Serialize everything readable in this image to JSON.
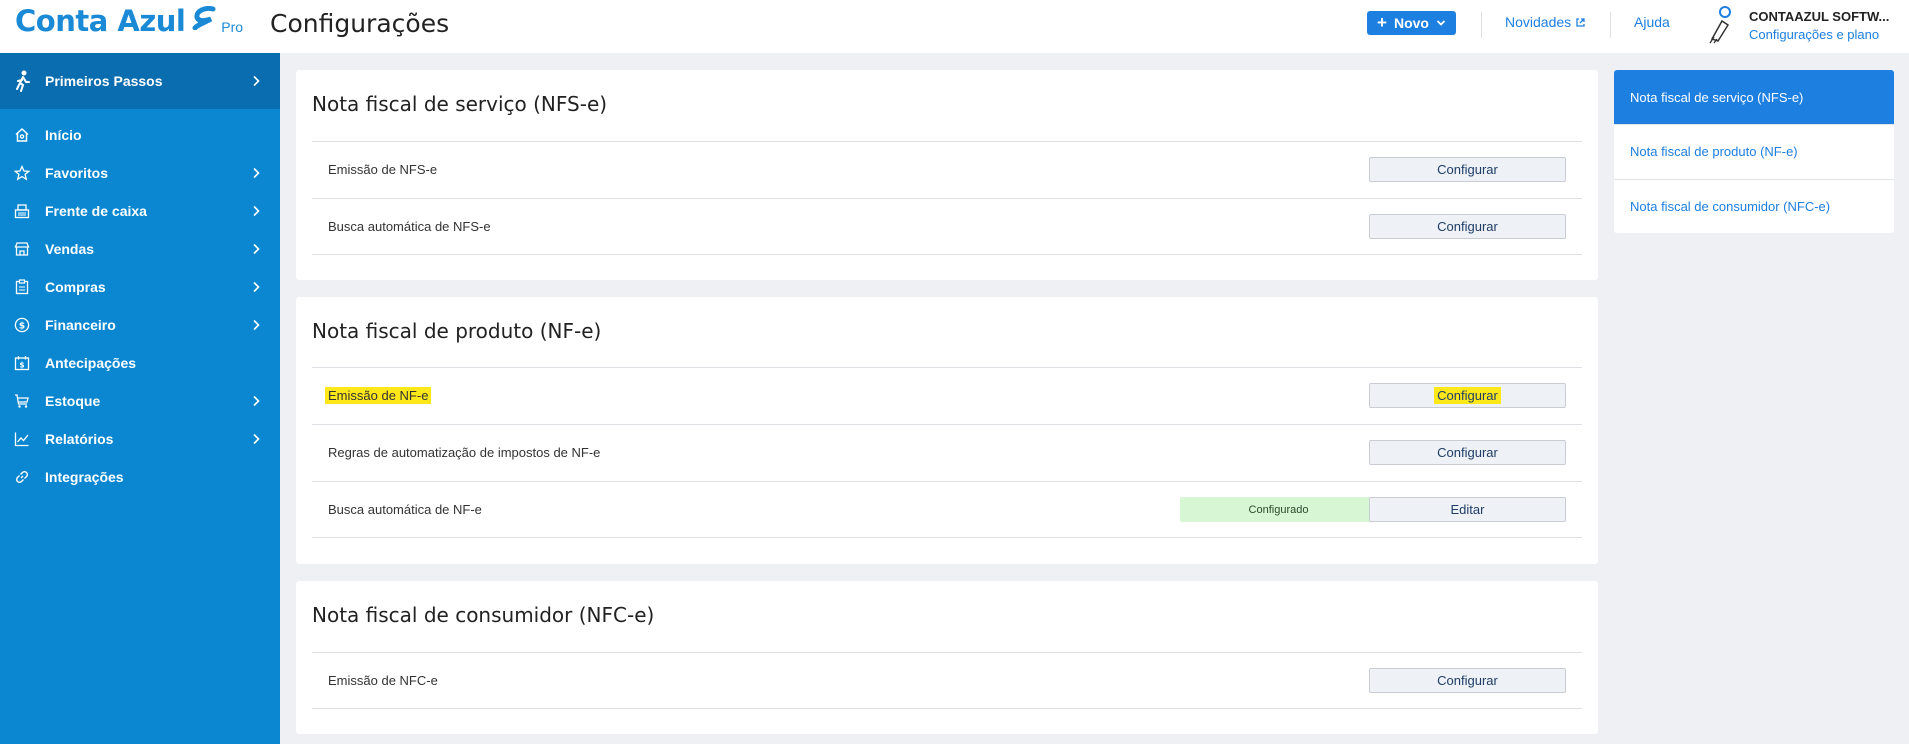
{
  "header": {
    "logo_text": "Conta Azul",
    "logo_badge": "Pro",
    "page_title": "Configurações",
    "new_button": "Novo",
    "news_link": "Novidades",
    "help_link": "Ajuda",
    "account_name": "CONTAAZUL SOFTW...",
    "account_sub": "Configurações e plano"
  },
  "sidebar": {
    "first": {
      "label": "Primeiros Passos",
      "icon": "walking-person-icon"
    },
    "items": [
      {
        "label": "Início",
        "icon": "home-icon",
        "has_submenu": false
      },
      {
        "label": "Favoritos",
        "icon": "star-icon",
        "has_submenu": true
      },
      {
        "label": "Frente de caixa",
        "icon": "cash-register-icon",
        "has_submenu": true
      },
      {
        "label": "Vendas",
        "icon": "store-icon",
        "has_submenu": true
      },
      {
        "label": "Compras",
        "icon": "clipboard-icon",
        "has_submenu": true
      },
      {
        "label": "Financeiro",
        "icon": "dollar-circle-icon",
        "has_submenu": true
      },
      {
        "label": "Antecipações",
        "icon": "calendar-dollar-icon",
        "has_submenu": false
      },
      {
        "label": "Estoque",
        "icon": "cart-icon",
        "has_submenu": true
      },
      {
        "label": "Relatórios",
        "icon": "chart-line-icon",
        "has_submenu": true
      },
      {
        "label": "Integrações",
        "icon": "link-icon",
        "has_submenu": false
      }
    ]
  },
  "sections": [
    {
      "title": "Nota fiscal de serviço (NFS-e)",
      "rows": [
        {
          "label": "Emissão de NFS-e",
          "button": "Configurar"
        },
        {
          "label": "Busca automática de NFS-e",
          "button": "Configurar"
        }
      ]
    },
    {
      "title": "Nota fiscal de produto (NF-e)",
      "rows": [
        {
          "label": "Emissão de NF-e",
          "button": "Configurar",
          "highlighted": true
        },
        {
          "label": "Regras de automatização de impostos de NF-e",
          "button": "Configurar"
        },
        {
          "label": "Busca automática de NF-e",
          "button": "Editar",
          "status": "Configurado"
        }
      ]
    },
    {
      "title": "Nota fiscal de consumidor (NFC-e)",
      "rows": [
        {
          "label": "Emissão de NFC-e",
          "button": "Configurar"
        }
      ]
    }
  ],
  "right_nav": {
    "items": [
      {
        "label": "Nota fiscal de serviço (NFS-e)",
        "active": true
      },
      {
        "label": "Nota fiscal de produto (NF-e)",
        "active": false
      },
      {
        "label": "Nota fiscal de consumidor (NFC-e)",
        "active": false
      }
    ]
  },
  "colors": {
    "brand": "#1a8ad6",
    "sidebar": "#0b87d1",
    "sidebar_active": "#0a6db0",
    "highlight": "#ffe81a",
    "status_ok_bg": "#d7f7d4"
  }
}
